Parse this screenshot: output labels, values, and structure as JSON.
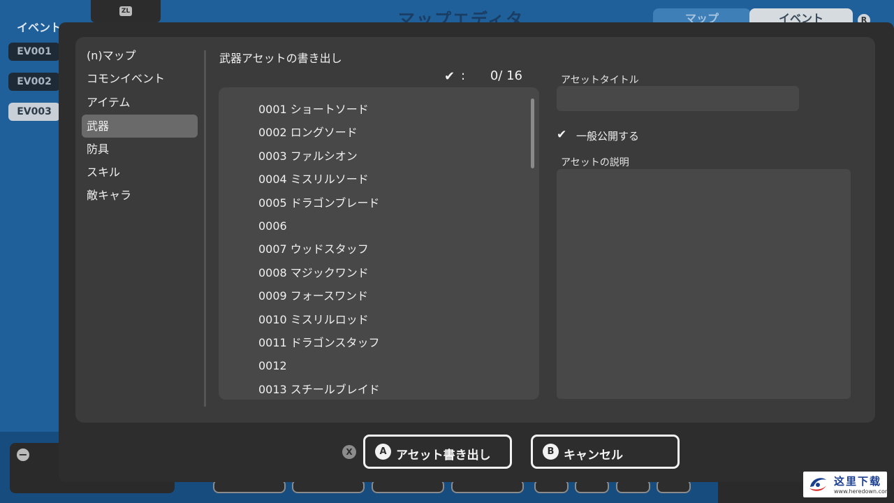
{
  "background": {
    "title": "マップエディタ",
    "side_label": "イベント",
    "zl_label": "ZL",
    "r_label": "R",
    "tabs": {
      "map": "マップ",
      "event": "イベント"
    },
    "events": [
      {
        "label": "EV001",
        "selected": false
      },
      {
        "label": "EV002",
        "selected": false
      },
      {
        "label": "EV003",
        "selected": true
      }
    ],
    "minus_icon": "−"
  },
  "dialog": {
    "categories": [
      {
        "label": "(n)マップ",
        "selected": false
      },
      {
        "label": "コモンイベント",
        "selected": false
      },
      {
        "label": "アイテム",
        "selected": false
      },
      {
        "label": "武器",
        "selected": true
      },
      {
        "label": "防具",
        "selected": false
      },
      {
        "label": "スキル",
        "selected": false
      },
      {
        "label": "敵キャラ",
        "selected": false
      }
    ],
    "section_title": "武器アセットの書き出し",
    "counter": {
      "check_icon": "✔",
      "colon": ":",
      "count": "0/ 16"
    },
    "assets": [
      "0001 ショートソード",
      "0002 ロングソード",
      "0003 ファルシオン",
      "0004 ミスリルソード",
      "0005 ドラゴンブレード",
      "0006",
      "0007 ウッドスタッフ",
      "0008 マジックワンド",
      "0009 フォースワンド",
      "0010 ミスリルロッド",
      "0011 ドラゴンスタッフ",
      "0012",
      "0013 スチールブレイド"
    ],
    "asset_title_label": "アセットタイトル",
    "asset_title_value": "",
    "public_checked": true,
    "public_check_icon": "✔",
    "public_label": "一般公開する",
    "description_label": "アセットの説明",
    "description_value": ""
  },
  "footer": {
    "x_badge": "X",
    "export_badge": "A",
    "export_label": "アセット書き出し",
    "cancel_badge": "B",
    "cancel_label": "キャンセル"
  },
  "watermark": {
    "chinese": "这里下载",
    "url": "www.heredown.com"
  }
}
